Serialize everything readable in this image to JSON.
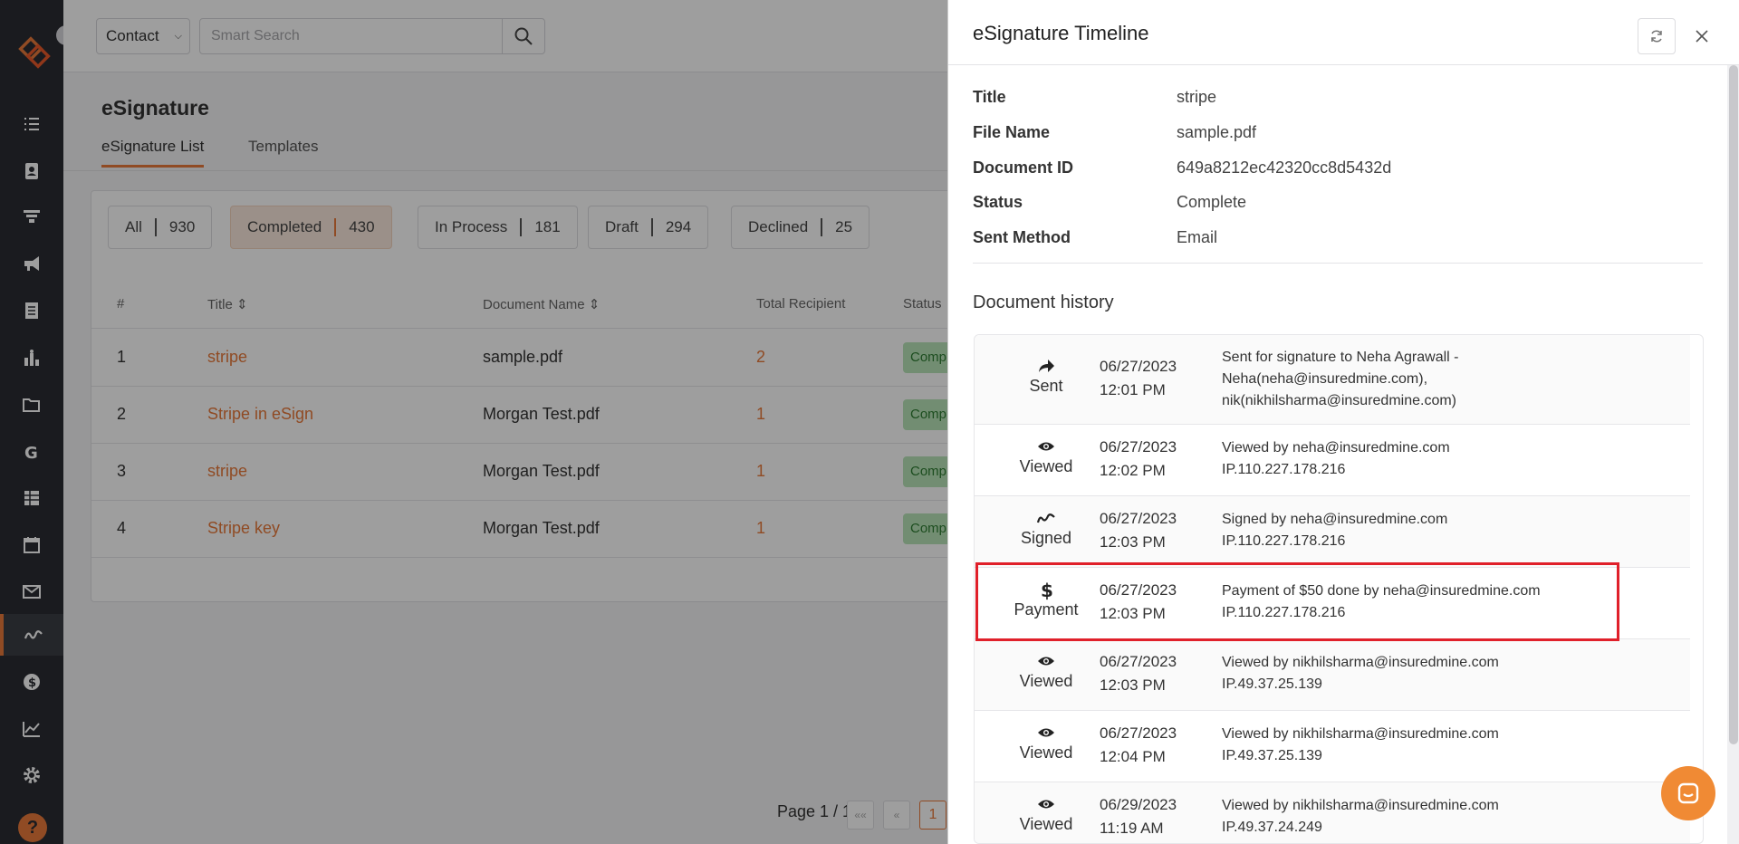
{
  "header": {
    "contact_select": "Contact",
    "search_placeholder": "Smart Search"
  },
  "page": {
    "title": "eSignature",
    "tabs": [
      {
        "label": "eSignature List",
        "active": true
      },
      {
        "label": "Templates",
        "active": false
      }
    ]
  },
  "filters": [
    {
      "label": "All",
      "count": "930",
      "active": false
    },
    {
      "label": "Completed",
      "count": "430",
      "active": true
    },
    {
      "label": "In Process",
      "count": "181",
      "active": false
    },
    {
      "label": "Draft",
      "count": "294",
      "active": false
    },
    {
      "label": "Declined",
      "count": "25",
      "active": false
    }
  ],
  "table": {
    "columns": [
      "#",
      "Title",
      "Document Name",
      "Total Recipient",
      "Status"
    ],
    "rows": [
      {
        "num": "1",
        "title": "stripe",
        "document": "sample.pdf",
        "recipients": "2",
        "status": "Completed"
      },
      {
        "num": "2",
        "title": "Stripe in eSign",
        "document": "Morgan Test.pdf",
        "recipients": "1",
        "status": "Completed"
      },
      {
        "num": "3",
        "title": "stripe",
        "document": "Morgan Test.pdf",
        "recipients": "1",
        "status": "Completed"
      },
      {
        "num": "4",
        "title": "Stripe key",
        "document": "Morgan Test.pdf",
        "recipients": "1",
        "status": "Completed"
      }
    ]
  },
  "pagination": {
    "label": "Page 1 / 1",
    "first": "««",
    "prev": "«",
    "current": "1"
  },
  "drawer": {
    "title": "eSignature Timeline",
    "info": [
      {
        "label": "Title",
        "value": "stripe"
      },
      {
        "label": "File Name",
        "value": "sample.pdf"
      },
      {
        "label": "Document ID",
        "value": "649a8212ec42320cc8d5432d"
      },
      {
        "label": "Status",
        "value": "Complete"
      },
      {
        "label": "Sent Method",
        "value": "Email"
      }
    ],
    "history_title": "Document history",
    "history": [
      {
        "icon": "share-arrow-icon",
        "type": "Sent",
        "date": "06/27/2023",
        "time": "12:01 PM",
        "lines": [
          "Sent for signature to Neha Agrawall -",
          "Neha(neha@insuredmine.com),",
          "nik(nikhilsharma@insuredmine.com)"
        ]
      },
      {
        "icon": "eye-icon",
        "type": "Viewed",
        "date": "06/27/2023",
        "time": "12:02 PM",
        "lines": [
          "Viewed by neha@insuredmine.com",
          "IP.110.227.178.216"
        ]
      },
      {
        "icon": "signature-icon",
        "type": "Signed",
        "date": "06/27/2023",
        "time": "12:03 PM",
        "lines": [
          "Signed by neha@insuredmine.com",
          "IP.110.227.178.216"
        ]
      },
      {
        "icon": "dollar-icon",
        "type": "Payment",
        "date": "06/27/2023",
        "time": "12:03 PM",
        "lines": [
          "Payment of $50 done by neha@insuredmine.com",
          "IP.110.227.178.216"
        ]
      },
      {
        "icon": "eye-icon",
        "type": "Viewed",
        "date": "06/27/2023",
        "time": "12:03 PM",
        "lines": [
          "Viewed by nikhilsharma@insuredmine.com",
          "IP.49.37.25.139"
        ]
      },
      {
        "icon": "eye-icon",
        "type": "Viewed",
        "date": "06/27/2023",
        "time": "12:04 PM",
        "lines": [
          "Viewed by nikhilsharma@insuredmine.com",
          "IP.49.37.25.139"
        ]
      },
      {
        "icon": "eye-icon",
        "type": "Viewed",
        "date": "06/29/2023",
        "time": "11:19 AM",
        "lines": [
          "Viewed by nikhilsharma@insuredmine.com",
          "IP.49.37.24.249"
        ]
      }
    ]
  },
  "colors": {
    "accent": "#e8793a",
    "sidebar": "#2a2d33",
    "highlight": "#e0202a",
    "status_green": "#b9e4b9"
  },
  "sidebar_icons": [
    "list-icon",
    "contacts-icon",
    "funnel-icon",
    "megaphone-icon",
    "document-icon",
    "analytics-icon",
    "folder-icon",
    "google-icon",
    "spreadsheet-icon",
    "calendar-icon",
    "mail-icon",
    "esignature-icon",
    "dollar-circle-icon",
    "chart-line-icon",
    "settings-icon"
  ],
  "help_glyph": "?"
}
